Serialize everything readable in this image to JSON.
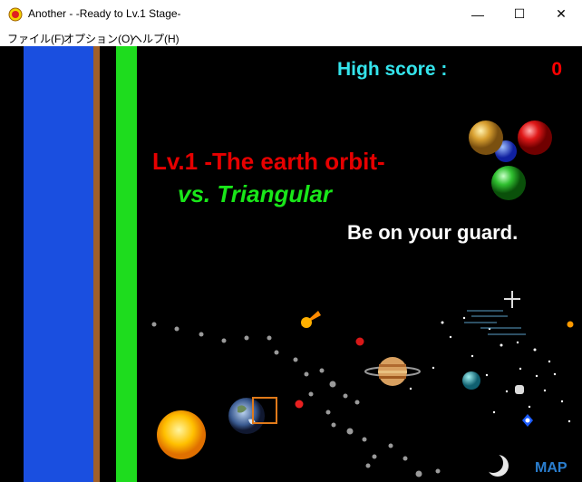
{
  "window": {
    "title": "Another - -Ready to Lv.1 Stage-",
    "minimize_glyph": "—",
    "maximize_glyph": "☐",
    "close_glyph": "✕"
  },
  "menu": {
    "items": [
      "ファイル(F)",
      "オプション(O)",
      "ヘルプ(H)"
    ]
  },
  "hud": {
    "high_score_label": "High score :",
    "high_score_value": "0",
    "map_label": "MAP"
  },
  "stage": {
    "title": "Lv.1 -The earth orbit-",
    "enemy": "vs. Triangular",
    "warning": "Be on your guard."
  },
  "colors": {
    "high_score_label": "#34e4ec",
    "high_score_value": "#ff0000",
    "stage_title": "#e60000",
    "enemy_text": "#19e619",
    "gauge_blue": "#1a4fe0",
    "gauge_brown": "#a0602a",
    "gauge_green": "#1edc1e",
    "map_label": "#2a7ecf"
  },
  "icons": [
    "app-icon",
    "triple-orb-icon",
    "sun-icon",
    "earth-icon",
    "jupiter-icon",
    "neptune-icon",
    "comet-icon",
    "moon-icon",
    "player-cursor-icon"
  ]
}
